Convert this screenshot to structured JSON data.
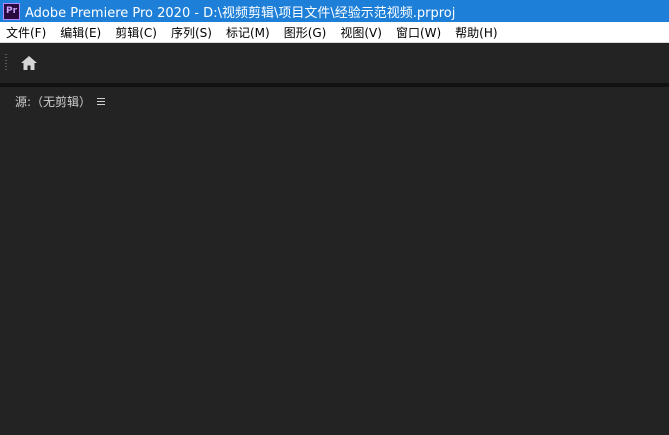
{
  "titlebar": {
    "app_icon_text": "Pr",
    "title": "Adobe Premiere Pro 2020 - D:\\视频剪辑\\项目文件\\经验示范视频.prproj",
    "bg_color": "#1d7fd8"
  },
  "menubar": {
    "items": [
      {
        "label": "文件(F)"
      },
      {
        "label": "编辑(E)"
      },
      {
        "label": "剪辑(C)"
      },
      {
        "label": "序列(S)"
      },
      {
        "label": "标记(M)"
      },
      {
        "label": "图形(G)"
      },
      {
        "label": "视图(V)"
      },
      {
        "label": "窗口(W)"
      },
      {
        "label": "帮助(H)"
      }
    ]
  },
  "toolbar": {
    "home_icon": "home-icon"
  },
  "source_panel": {
    "title": "源:（无剪辑）",
    "menu_icon": "hamburger-menu-icon"
  }
}
